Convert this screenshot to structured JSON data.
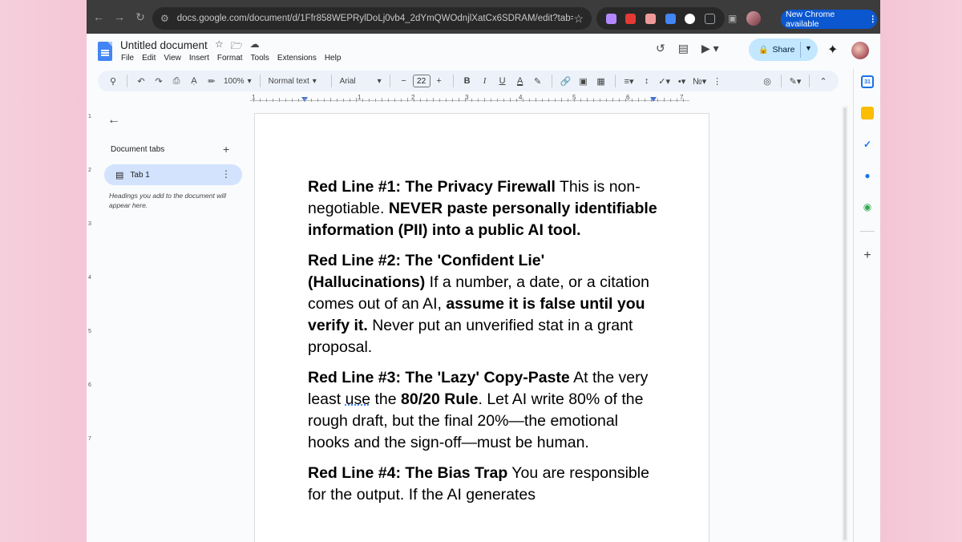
{
  "browser": {
    "url": "docs.google.com/document/d/1Ffr858WEPRylDoLj0vb4_2dYmQWOdnjlXatCx6SDRAM/edit?tab=t.0",
    "update_label": "New Chrome available",
    "extension_colors": [
      "#b388ff",
      "#e53935",
      "#ef5350",
      "#4285f4",
      "#ffffff",
      "#9aa0a6"
    ]
  },
  "docs": {
    "title": "Untitled document",
    "menu": [
      "File",
      "Edit",
      "View",
      "Insert",
      "Format",
      "Tools",
      "Extensions",
      "Help"
    ],
    "share_label": "Share"
  },
  "toolbar": {
    "zoom": "100%",
    "style": "Normal text",
    "font": "Arial",
    "font_size": "22",
    "bold": "B",
    "italic": "I",
    "underline": "U",
    "text_color_letter": "A"
  },
  "ruler": {
    "numbers": [
      "1",
      "1",
      "2",
      "3",
      "4",
      "5",
      "6",
      "7"
    ]
  },
  "vruler": {
    "numbers": [
      "1",
      "2",
      "3",
      "4",
      "5",
      "6",
      "7"
    ]
  },
  "tabs_panel": {
    "heading": "Document tabs",
    "tab_label": "Tab 1",
    "hint": "Headings you add to the document will appear here."
  },
  "document": {
    "p1": {
      "b1": "Red Line #1: The Privacy Firewall",
      "t1": " This is non-negotiable. ",
      "b2": "NEVER paste personally identifiable information (PII) into a public AI tool."
    },
    "p2": {
      "b1": "Red Line #2: The 'Confident Lie' (Hallucinations)",
      "t1": " If a number, a date, or a citation comes out of an AI, ",
      "b2": "assume it is false until you verify it.",
      "t2": " Never put an unverified stat in a grant proposal."
    },
    "p3": {
      "b1": "Red Line #3: The 'Lazy' Copy-Paste",
      "t1": " At the very least ",
      "u1": "use",
      "t2": " the ",
      "b2": "80/20 Rule",
      "t3": ". Let AI write 80% of the rough draft, but the final 20%—the emotional hooks and the sign-off—must be human."
    },
    "p4": {
      "b1": "Red Line #4: The Bias Trap",
      "t1": " You are responsible for the output. If the AI generates"
    }
  },
  "side_panel_colors": {
    "calendar": "#1a73e8",
    "keep": "#fbbc04",
    "tasks": "#1a73e8",
    "contacts": "#1a73e8",
    "maps": "#34a853"
  }
}
